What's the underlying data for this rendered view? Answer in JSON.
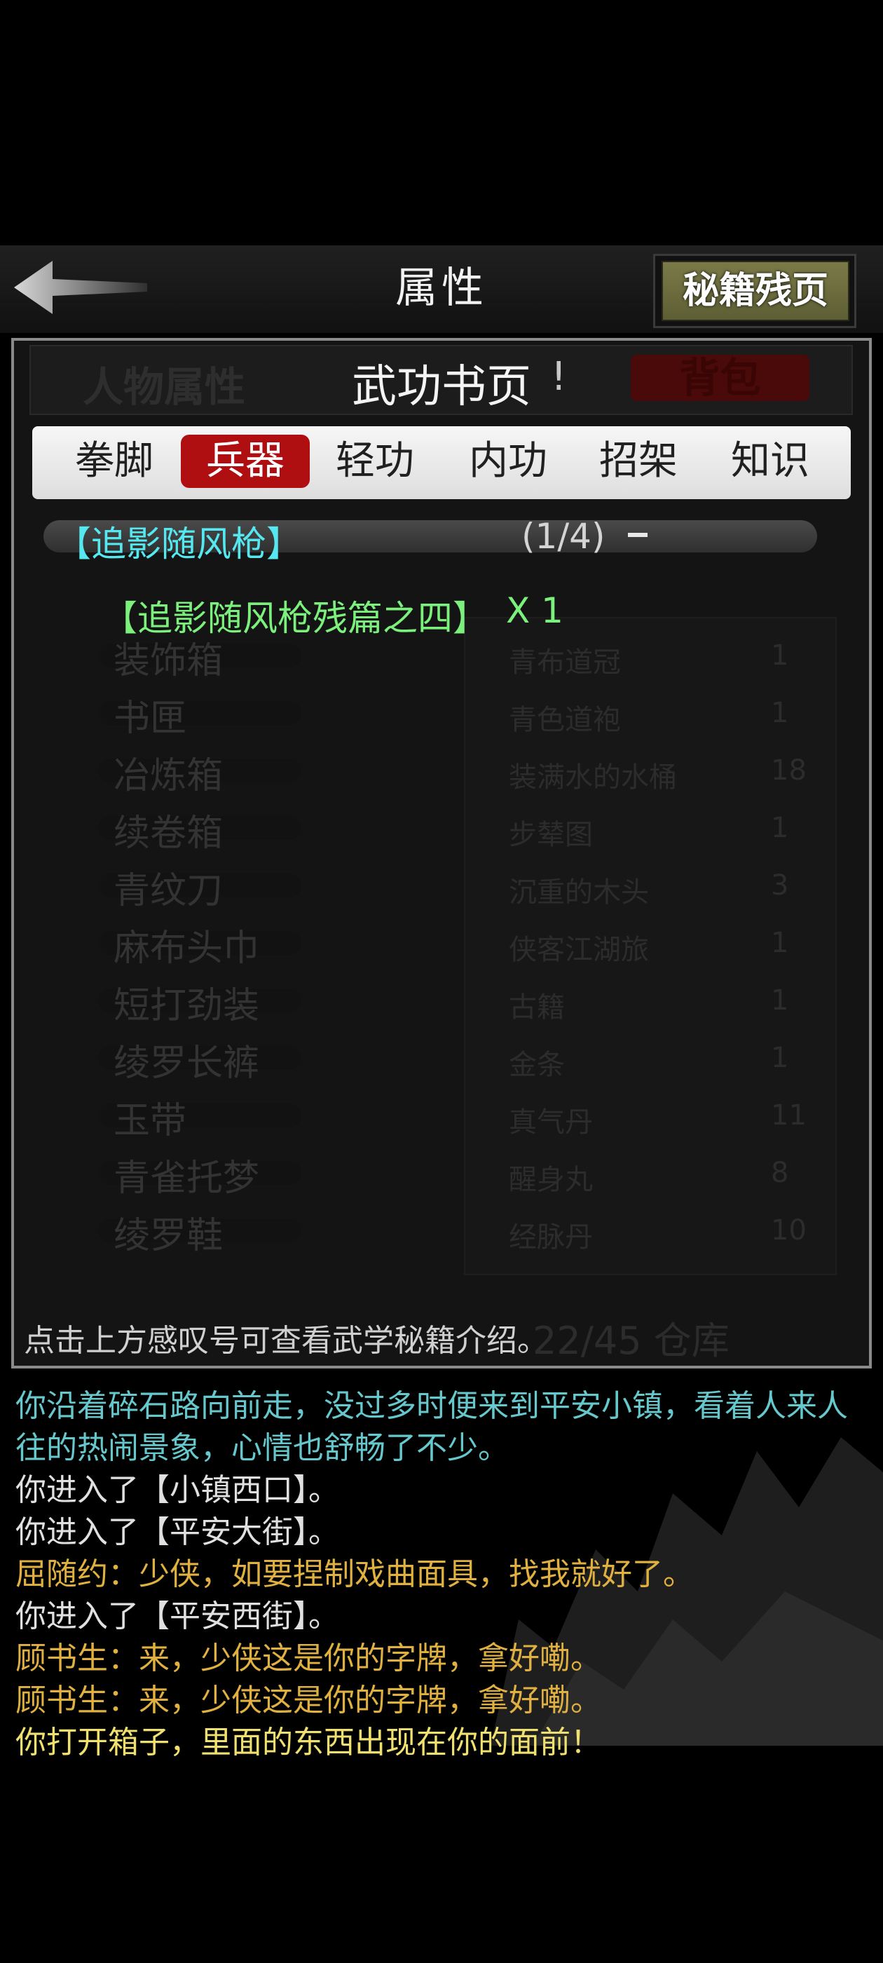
{
  "header": {
    "title": "属性",
    "secret_button": "秘籍残页"
  },
  "panel": {
    "book_title": "武功书页",
    "info_mark": "!",
    "faded_tab_left": "人物属性",
    "faded_tab_right": "背包",
    "categories": [
      "拳脚",
      "兵器",
      "轻功",
      "内功",
      "招架",
      "知识"
    ],
    "active_category": "兵器",
    "skill": {
      "name": "【追影随风枪】",
      "progress": "(1/4)"
    },
    "fragment": {
      "name": "【追影随风枪残篇之四】",
      "count": "X 1"
    },
    "hint": "点击上方感叹号可查看武学秘籍介绍。",
    "ghost_capacity": "22/45 仓库",
    "ghost_left_items": [
      "装饰箱",
      "书匣",
      "冶炼箱",
      "续卷箱",
      "青纹刀",
      "麻布头巾",
      "短打劲装",
      "绫罗长裤",
      "玉带",
      "青雀托梦",
      "绫罗鞋"
    ],
    "ghost_right_items": [
      {
        "name": "青布道冠",
        "qty": "1"
      },
      {
        "name": "青色道袍",
        "qty": "1"
      },
      {
        "name": "装满水的水桶",
        "qty": "18"
      },
      {
        "name": "步辇图",
        "qty": "1"
      },
      {
        "name": "沉重的木头",
        "qty": "3"
      },
      {
        "name": "侠客江湖旅",
        "qty": "1"
      },
      {
        "name": "古籍",
        "qty": "1"
      },
      {
        "name": "金条",
        "qty": "1"
      },
      {
        "name": "真气丹",
        "qty": "11"
      },
      {
        "name": "醒身丸",
        "qty": "8"
      },
      {
        "name": "经脉丹",
        "qty": "10"
      }
    ]
  },
  "log": [
    {
      "text": "你沿着碎石路向前走，没过多时便来到平安小镇，看着人来人往的热闹景象，心情也舒畅了不少。",
      "color": "#66c8cc"
    },
    {
      "text": "你进入了【小镇西口】。",
      "color": "#e0e0e0"
    },
    {
      "text": "你进入了【平安大街】。",
      "color": "#e0e0e0"
    },
    {
      "text": "屈随约：少侠，如要捏制戏曲面具，找我就好了。",
      "color": "#e0b040"
    },
    {
      "text": "你进入了【平安西街】。",
      "color": "#e0e0e0"
    },
    {
      "text": "顾书生：来，少侠这是你的字牌，拿好嘞。",
      "color": "#e0b040"
    },
    {
      "text": "顾书生：来，少侠这是你的字牌，拿好嘞。",
      "color": "#e0b040"
    },
    {
      "text": "你打开箱子，里面的东西出现在你的面前！",
      "color": "#f0e070"
    }
  ]
}
